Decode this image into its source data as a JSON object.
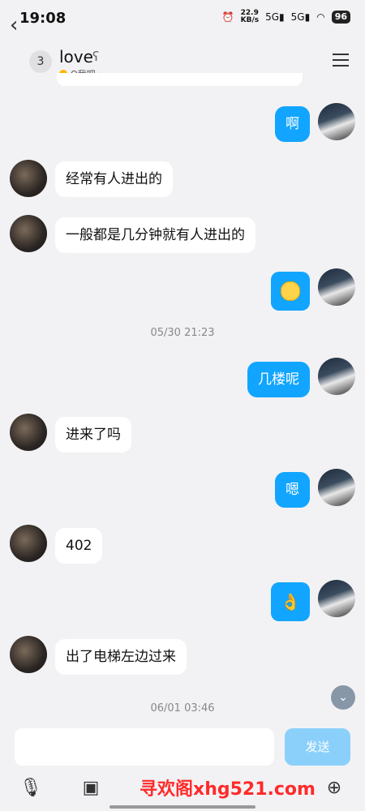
{
  "status_bar": {
    "time": "19:08",
    "speed_value": "22.9",
    "speed_unit": "KB/s",
    "signal1": "5G",
    "signal2": "5G",
    "battery": "96"
  },
  "header": {
    "back_count": "3",
    "contact_name": "love",
    "subtitle": "Q我吧"
  },
  "messages": [
    {
      "side": "out",
      "text": "啊"
    },
    {
      "side": "in",
      "text": "经常有人进出的"
    },
    {
      "side": "in",
      "text": "一般都是几分钟就有人进出的"
    },
    {
      "side": "out",
      "type": "emoji",
      "icon": "yawn-face"
    },
    {
      "timestamp": "05/30 21:23"
    },
    {
      "side": "out",
      "text": "几楼呢"
    },
    {
      "side": "in",
      "text": "进来了吗"
    },
    {
      "side": "out",
      "text": "嗯"
    },
    {
      "side": "in",
      "text": "402"
    },
    {
      "side": "out",
      "type": "emoji",
      "icon": "ok-hand"
    },
    {
      "side": "in",
      "text": "出了电梯左边过来"
    },
    {
      "timestamp": "06/01 03:46"
    }
  ],
  "composer": {
    "send_label": "发送"
  },
  "toolbar": {
    "icons": [
      "microphone-icon",
      "image-icon",
      "emoji-icon",
      "plus-icon"
    ]
  },
  "watermark": "寻欢阁xhg521.com"
}
